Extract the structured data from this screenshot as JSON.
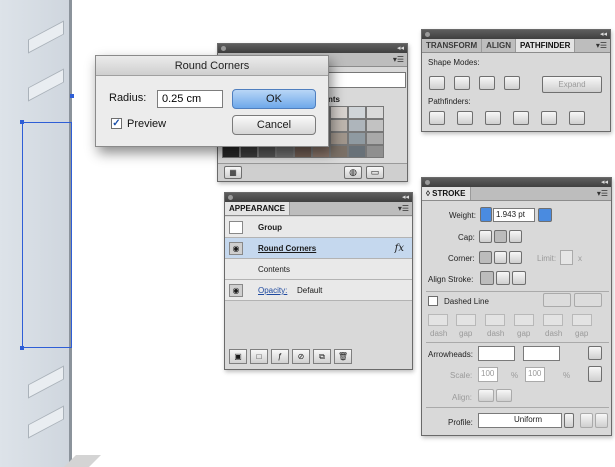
{
  "dialog": {
    "title": "Round Corners",
    "radius_label": "Radius:",
    "radius_value": "0.25 cm",
    "preview_label": "Preview",
    "preview_checked": true,
    "ok_label": "OK",
    "cancel_label": "Cancel"
  },
  "pathfinder": {
    "tabs": [
      "TRANSFORM",
      "ALIGN",
      "PATHFINDER"
    ],
    "active_tab": "PATHFINDER",
    "shape_modes_label": "Shape Modes:",
    "pathfinders_label": "Pathfinders:",
    "expand_label": "Expand"
  },
  "swatches": {
    "column_header": "Tints"
  },
  "appearance": {
    "tab": "APPEARANCE",
    "rows": {
      "group": "Group",
      "round_corners": "Round Corners",
      "contents": "Contents",
      "opacity_label": "Opacity:",
      "opacity_value": "Default",
      "fx": "fx"
    }
  },
  "stroke": {
    "tab": "◊ STROKE",
    "weight_label": "Weight:",
    "weight_value": "1.943 pt",
    "cap_label": "Cap:",
    "corner_label": "Corner:",
    "limit_label": "Limit:",
    "limit_unit": "x",
    "align_label": "Align Stroke:",
    "dashed_label": "Dashed Line",
    "dash_labels": [
      "dash",
      "gap",
      "dash",
      "gap",
      "dash",
      "gap"
    ],
    "arrowheads_label": "Arrowheads:",
    "scale_label": "Scale:",
    "scale_value_1": "100",
    "scale_value_2": "100",
    "percent": "%",
    "align_arrow_label": "Align:",
    "profile_label": "Profile:",
    "profile_value": "Uniform"
  },
  "colors": {
    "ok_button": "#6ea8ea",
    "selection": "#2e5ed6",
    "panel_bg": "#d9d9d9"
  }
}
